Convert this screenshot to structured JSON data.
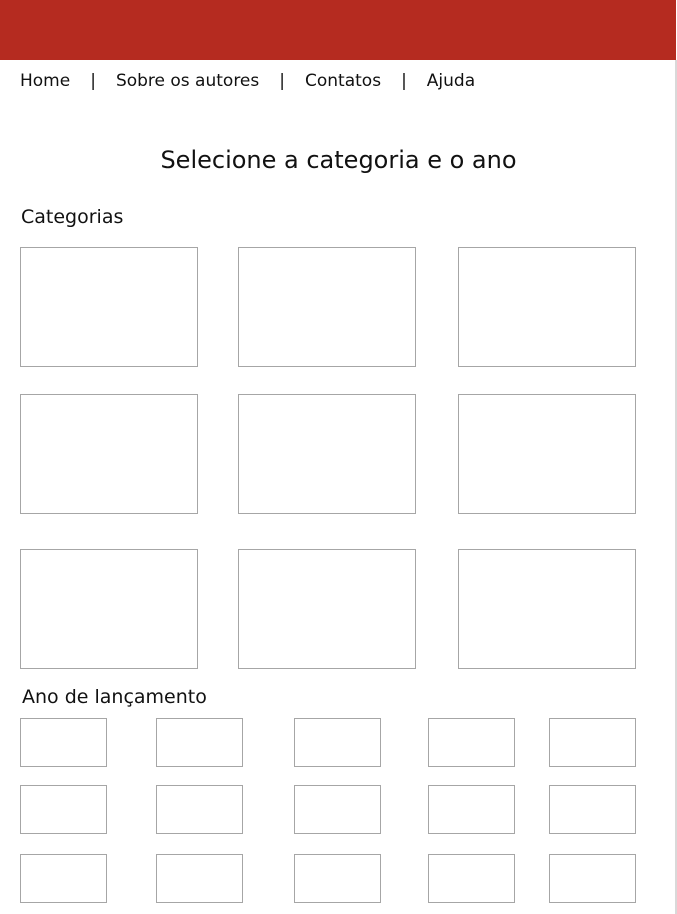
{
  "colors": {
    "header": "#b52b20"
  },
  "nav": {
    "items": [
      {
        "label": "Home"
      },
      {
        "label": "Sobre os autores"
      },
      {
        "label": "Contatos"
      },
      {
        "label": "Ajuda"
      }
    ],
    "separator": "|"
  },
  "main": {
    "title": "Selecione a categoria e o ano",
    "categories_label": "Categorias",
    "year_label": "Ano de lançamento"
  }
}
